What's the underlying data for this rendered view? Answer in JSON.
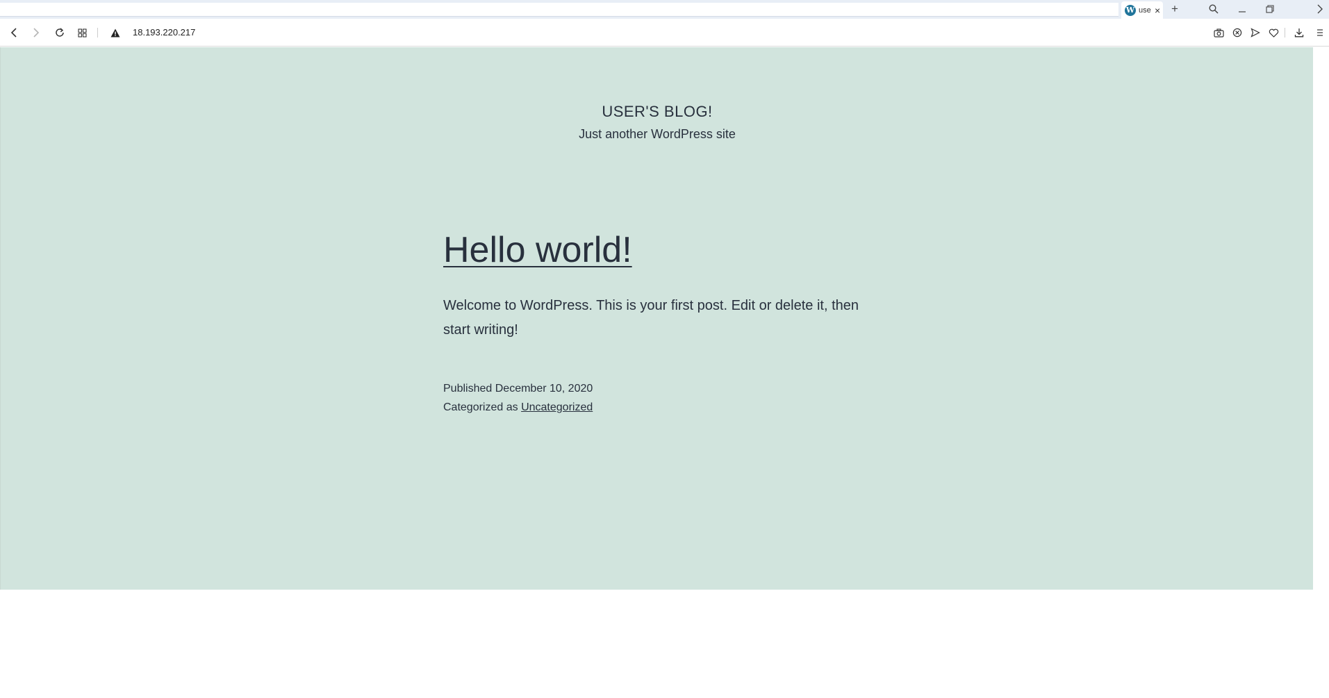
{
  "browser": {
    "tab": {
      "favicon": "wordpress-icon",
      "title": "use",
      "close": "×"
    },
    "new_tab": "+",
    "window_controls": [
      "search-icon",
      "minimize-icon",
      "restore-icon",
      "more-icon"
    ],
    "nav": {
      "back": "back-icon",
      "forward": "forward-icon",
      "reload": "reload-icon",
      "speed_dial": "speed-dial-icon"
    },
    "address": {
      "security": "warning-icon",
      "url": "18.193.220.217"
    },
    "toolbar_icons": [
      "camera-icon",
      "block-icon",
      "send-icon",
      "heart-icon",
      "download-icon",
      "menu-icon"
    ]
  },
  "site": {
    "title": "USER'S BLOG!",
    "description": "Just another WordPress site",
    "background": "#d1e4dd"
  },
  "post": {
    "title": "Hello world!",
    "excerpt": "Welcome to WordPress. This is your first post. Edit or delete it, then start writing!",
    "published_prefix": "Published",
    "published_date": "December 10, 2020",
    "category_prefix": "Categorized as",
    "category": "Uncategorized"
  }
}
